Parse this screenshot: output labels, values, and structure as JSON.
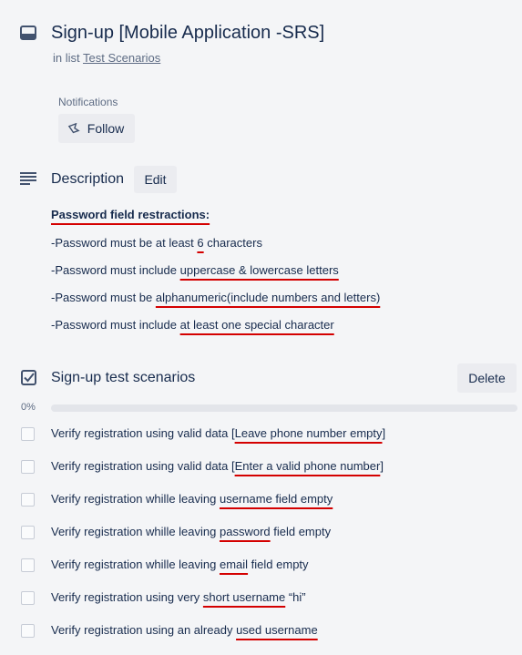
{
  "card": {
    "title": "Sign-up [Mobile Application -SRS]",
    "in_list_prefix": "in list ",
    "list_name": "Test Scenarios"
  },
  "notifications": {
    "label": "Notifications",
    "follow_label": "Follow"
  },
  "description": {
    "title": "Description",
    "edit_label": "Edit",
    "heading": "Password field restractions:",
    "lines": [
      {
        "pre": "-Password must be at least ",
        "hl": "6",
        "post": " characters"
      },
      {
        "pre": "-Password must include ",
        "hl": "uppercase & lowercase letters",
        "post": ""
      },
      {
        "pre": "-Password must be ",
        "hl": "alphanumeric(include numbers and letters)",
        "post": ""
      },
      {
        "pre": "-Password must include ",
        "hl": "at least one special character",
        "post": ""
      }
    ]
  },
  "checklist": {
    "title": "Sign-up test scenarios",
    "delete_label": "Delete",
    "progress_text": "0%",
    "progress": 0,
    "items": [
      {
        "pre": "Verify registration using valid data [",
        "hl": "Leave phone number empty",
        "post": "]"
      },
      {
        "pre": "Verify registration using valid data [",
        "hl": "Enter a valid phone number",
        "post": "]"
      },
      {
        "pre": "Verify registration whille leaving ",
        "hl": "username field empty",
        "post": ""
      },
      {
        "pre": "Verify registration whille leaving ",
        "hl": "password",
        "post": " field empty"
      },
      {
        "pre": "Verify registration whille leaving ",
        "hl": "email",
        "post": " field empty"
      },
      {
        "pre": "Verify registration using very ",
        "hl": "short username",
        "post": " “hi”"
      },
      {
        "pre": "Verify registration using an already ",
        "hl": "used username",
        "post": ""
      }
    ]
  },
  "colors": {
    "background": "#f4f5f7",
    "button": "#ebecf0",
    "annotation_underline": "#d40000"
  }
}
